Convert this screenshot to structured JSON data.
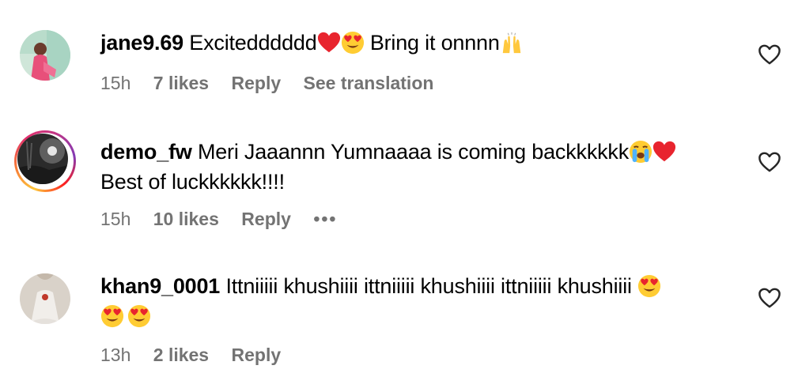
{
  "comments": [
    {
      "username": "jane9.69",
      "text_line1": "Excitedddddd",
      "text_line1_after": " Bring it onnnn",
      "time": "15h",
      "likes": "7 likes",
      "reply": "Reply",
      "extra": "See translation"
    },
    {
      "username": "demo_fw",
      "text_line1": "Meri Jaaannn Yumnaaaa is coming backkkkkk",
      "text_line2": "Best of luckkkkkk!!!!",
      "time": "15h",
      "likes": "10 likes",
      "reply": "Reply",
      "extra": "•••"
    },
    {
      "username": "khan9_0001",
      "text_line1": "Ittniiiii khushiiii ittniiiii khushiiii ittniiiii khushiiii",
      "time": "13h",
      "likes": "2 likes",
      "reply": "Reply"
    }
  ],
  "icons": {
    "like": "heart-outline-icon",
    "red_heart": "red-heart-emoji",
    "heart_eyes": "heart-eyes-emoji",
    "raised_hands": "raised-hands-emoji",
    "crying": "loudly-crying-emoji"
  },
  "colors": {
    "meta_gray": "#737373",
    "heart_red": "#e8242e"
  }
}
